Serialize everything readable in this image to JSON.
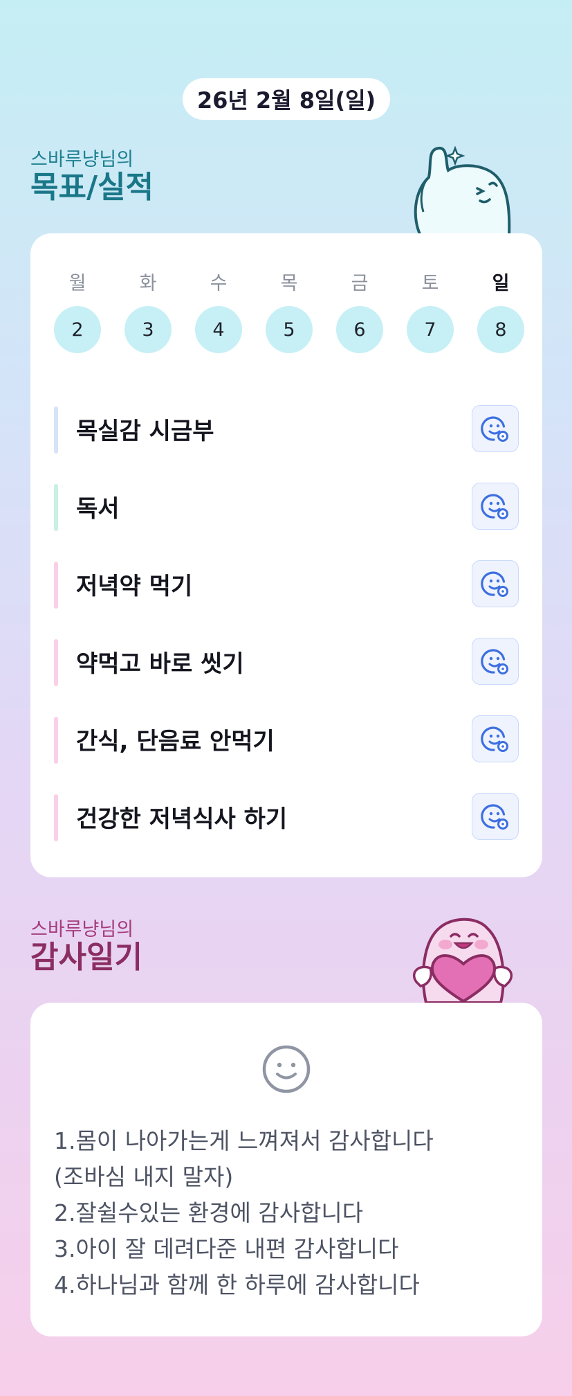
{
  "date": "26년 2월 8일(일)",
  "goal_section": {
    "subtitle": "스바루냥님의",
    "title": "목표/실적"
  },
  "week": [
    {
      "name": "월",
      "num": "2",
      "today": false
    },
    {
      "name": "화",
      "num": "3",
      "today": false
    },
    {
      "name": "수",
      "num": "4",
      "today": false
    },
    {
      "name": "목",
      "num": "5",
      "today": false
    },
    {
      "name": "금",
      "num": "6",
      "today": false
    },
    {
      "name": "토",
      "num": "7",
      "today": false
    },
    {
      "name": "일",
      "num": "8",
      "today": true
    }
  ],
  "goals": [
    {
      "label": "목실감 시금부",
      "color": "#d7e3f7",
      "icon": "smile-add-icon"
    },
    {
      "label": "독서",
      "color": "#c9f0e2",
      "icon": "smile-add-icon"
    },
    {
      "label": "저녁약 먹기",
      "color": "#f9d0e8",
      "icon": "smile-add-icon"
    },
    {
      "label": "약먹고 바로 씻기",
      "color": "#f9d0e8",
      "icon": "smile-add-icon"
    },
    {
      "label": "간식, 단음료 안먹기",
      "color": "#f9d0e8",
      "icon": "smile-add-icon"
    },
    {
      "label": "건강한 저녁식사 하기",
      "color": "#f9d0e8",
      "icon": "smile-add-icon"
    }
  ],
  "thanks_section": {
    "subtitle": "스바루냥님의",
    "title": "감사일기"
  },
  "thanks_lines": [
    "1.몸이 나아가는게 느껴져서 감사합니다",
    "(조바심 내지 말자)",
    "2.잘쉴수있는 환경에 감사합니다",
    "3.아이 잘 데려다준 내편 감사합니다",
    "4.하나님과 함께 한 하루에 감사합니다"
  ],
  "colors": {
    "accent_blue": "#3d6fe0",
    "day_circle": "#c6f0f5",
    "goal_title": "#1a7788",
    "thanks_title": "#8b2d63"
  }
}
